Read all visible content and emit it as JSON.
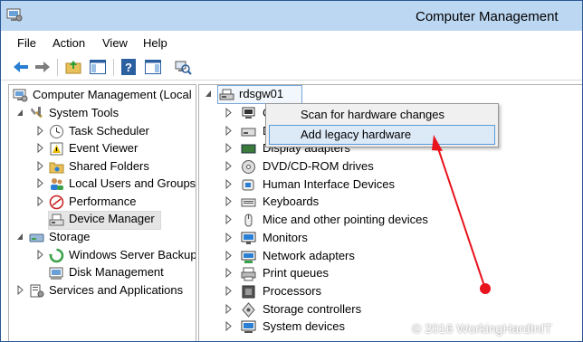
{
  "window": {
    "title": "Computer Management"
  },
  "menu": [
    "File",
    "Action",
    "View",
    "Help"
  ],
  "toolbar": {
    "icons": [
      "back-icon",
      "forward-icon",
      "up-folder-icon",
      "show-hide-console-tree-icon",
      "help-icon",
      "properties-icon",
      "scan-hardware-icon"
    ]
  },
  "left_tree": {
    "root": "Computer Management (Local",
    "system_tools": "System Tools",
    "task_scheduler": "Task Scheduler",
    "event_viewer": "Event Viewer",
    "shared_folders": "Shared Folders",
    "local_users": "Local Users and Groups",
    "performance": "Performance",
    "device_manager": "Device Manager",
    "storage": "Storage",
    "windows_server_backup": "Windows Server Backup",
    "disk_management": "Disk Management",
    "services_apps": "Services and Applications"
  },
  "device_tree": {
    "computer": "rdsgw01",
    "partial": [
      "C",
      "D",
      "Display adapters"
    ],
    "categories": [
      "DVD/CD-ROM drives",
      "Human Interface Devices",
      "Keyboards",
      "Mice and other pointing devices",
      "Monitors",
      "Network adapters",
      "Print queues",
      "Processors",
      "Storage controllers",
      "System devices"
    ]
  },
  "context_menu": {
    "items": [
      "Scan for hardware changes",
      "Add legacy hardware"
    ]
  },
  "watermark": "© 2016 WorkingHardInIT",
  "colors": {
    "titlebar": "#bcd7f2",
    "arrow": "#e8141e",
    "highlight": "#dce9f7"
  }
}
